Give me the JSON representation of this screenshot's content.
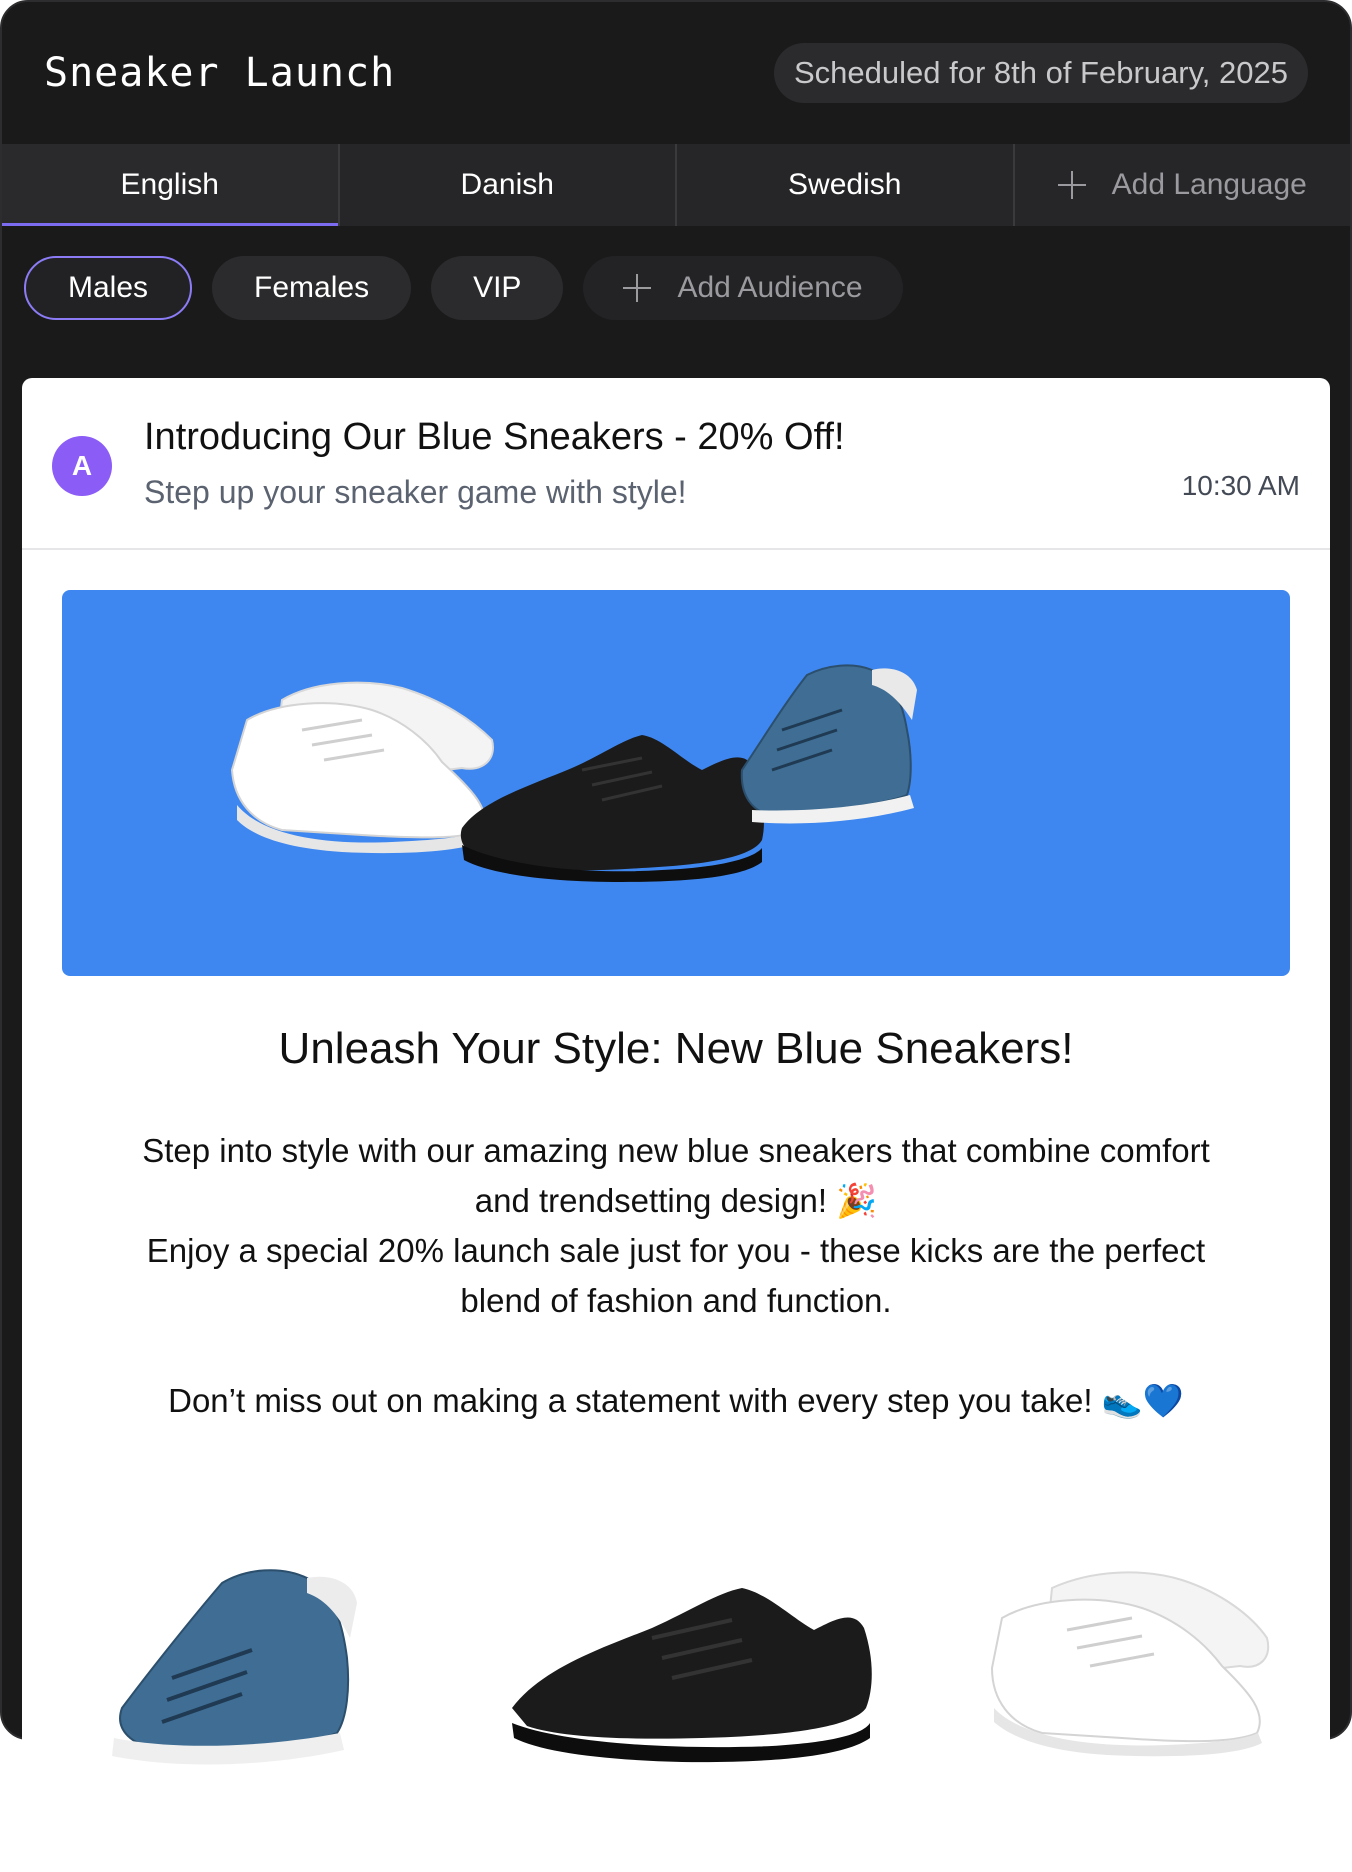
{
  "header": {
    "title": "Sneaker Launch",
    "schedule": "Scheduled for 8th of February, 2025"
  },
  "languages": {
    "tabs": [
      {
        "label": "English",
        "active": true
      },
      {
        "label": "Danish",
        "active": false
      },
      {
        "label": "Swedish",
        "active": false
      }
    ],
    "add_label": "Add Language"
  },
  "audiences": {
    "items": [
      {
        "label": "Males",
        "active": true
      },
      {
        "label": "Females",
        "active": false
      },
      {
        "label": "VIP",
        "active": false
      }
    ],
    "add_label": "Add Audience"
  },
  "email": {
    "avatar_initial": "A",
    "subject": "Introducing Our Blue Sneakers - 20% Off!",
    "preheader": "Step up your sneaker game with style!",
    "time": "10:30 AM",
    "title": "Unleash Your Style: New Blue Sneakers!",
    "paragraph1_line1": "Step into style with our amazing new blue sneakers that combine comfort",
    "paragraph1_line2": "and trendsetting design! 🎉",
    "paragraph2_line1": "Enjoy a special 20% launch sale just for you - these kicks are the perfect",
    "paragraph2_line2": "blend of fashion and function.",
    "paragraph3": "Don’t miss out on making a statement with every step you take! 👟💙"
  },
  "colors": {
    "accent": "#7c6cf2",
    "hero_background": "#3f87f0",
    "avatar": "#8b5cf6",
    "app_background": "#1a1a1b"
  }
}
